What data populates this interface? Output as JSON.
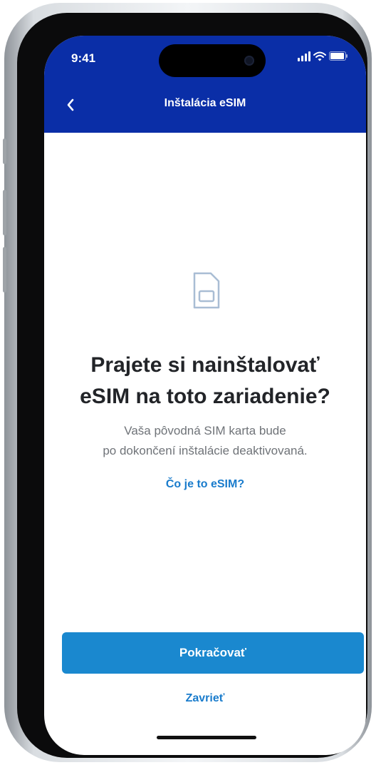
{
  "status_bar": {
    "time": "9:41"
  },
  "nav": {
    "title": "Inštalácia eSIM",
    "back_icon": "chevron-left-icon"
  },
  "main": {
    "icon": "sim-card-icon",
    "headline_line1": "Prajete si nainštalovať",
    "headline_line2": "eSIM na toto zariadenie?",
    "subtitle_line1": "Vaša pôvodná SIM karta bude",
    "subtitle_line2": "po dokončení inštalácie deaktivovaná.",
    "link": "Čo je to eSIM?"
  },
  "actions": {
    "primary": "Pokračovať",
    "secondary": "Zavrieť"
  },
  "colors": {
    "header": "#0a2ea7",
    "primary_button": "#1a88cf",
    "link": "#1a7ccc",
    "headline": "#222428",
    "subtitle": "#6f7378",
    "icon": "#a9bdd4"
  }
}
